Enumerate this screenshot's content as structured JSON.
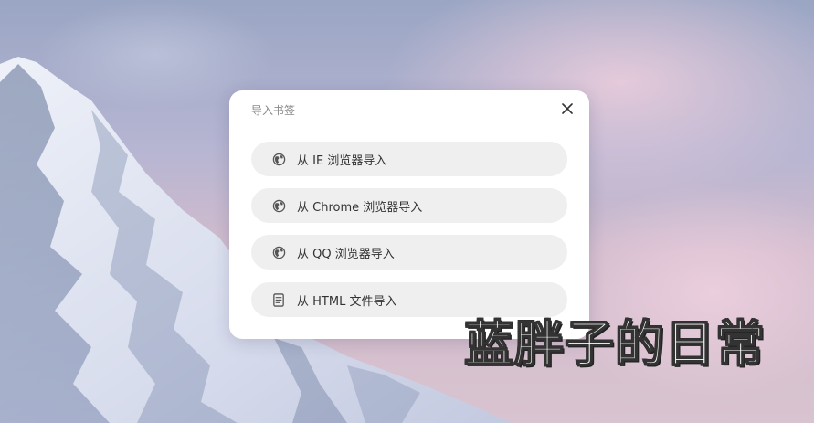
{
  "dialog": {
    "title": "导入书签",
    "close_icon": "close-icon",
    "options": [
      {
        "label": "从 IE 浏览器导入",
        "icon": "globe-icon"
      },
      {
        "label": "从 Chrome 浏览器导入",
        "icon": "globe-icon"
      },
      {
        "label": "从 QQ 浏览器导入",
        "icon": "globe-icon"
      },
      {
        "label": "从 HTML 文件导入",
        "icon": "document-icon"
      }
    ]
  },
  "watermark": {
    "text": "蓝胖子的日常"
  },
  "colors": {
    "dialog_bg": "#ffffff",
    "option_bg": "#efefef",
    "title_text": "#8a8a8a",
    "label_text": "#333333",
    "icon": "#555555"
  }
}
